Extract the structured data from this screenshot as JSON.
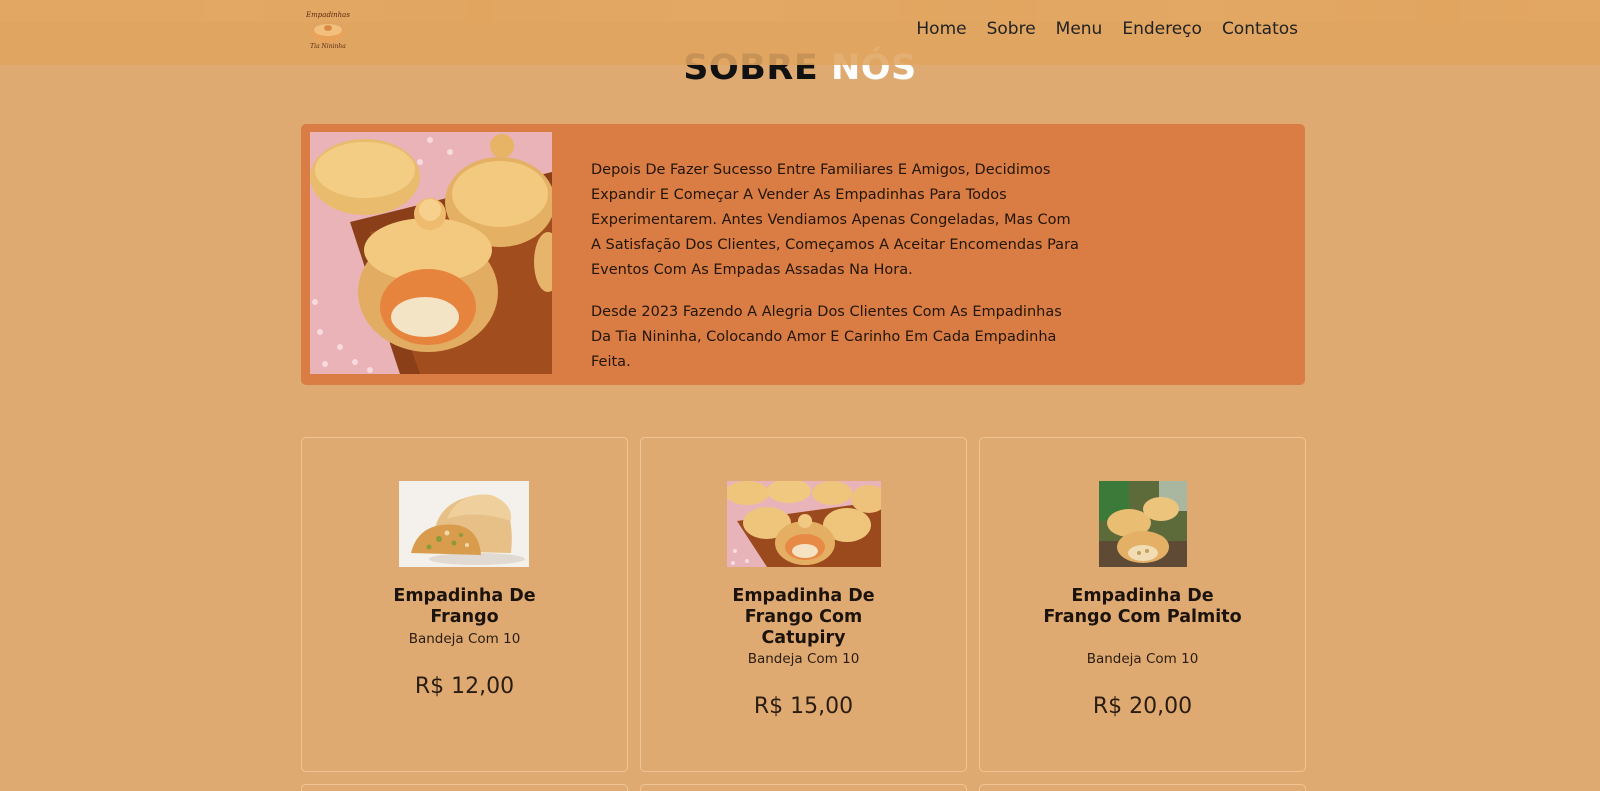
{
  "nav": {
    "logo_text_top": "Empadinhas",
    "logo_text_bottom": "Tia Nininha",
    "links": [
      "Home",
      "Sobre",
      "Menu",
      "Endereço",
      "Contatos"
    ]
  },
  "about": {
    "title_part1": "SOBRE",
    "title_part2": "NÓS",
    "paragraph1": "Depois De Fazer Sucesso Entre Familiares E Amigos, Decidimos Expandir E Começar A Vender As Empadinhas Para Todos Experimentarem. Antes Vendiamos Apenas Congeladas, Mas Com A Satisfação Dos Clientes, Começamos A Aceitar Encomendas Para Eventos Com As Empadas Assadas Na Hora.",
    "paragraph2": "Desde 2023 Fazendo A Alegria Dos Clientes Com As Empadinhas Da Tia Nininha, Colocando Amor E Carinho Em Cada Empadinha Feita."
  },
  "products": [
    {
      "name": "Empadinha De Frango",
      "desc": "Bandeja Com 10",
      "price": "R$ 12,00"
    },
    {
      "name": "Empadinha De Frango Com Catupiry",
      "desc": "Bandeja Com 10",
      "price": "R$ 15,00"
    },
    {
      "name": "Empadinha De Frango Com Palmito",
      "desc": "Bandeja Com 10",
      "price": "R$ 20,00"
    }
  ],
  "colors": {
    "page_bg": "#dfaa72",
    "navbar_bg": "#e0a45e",
    "about_card_bg": "#d97d44",
    "card_border": "#efc595"
  }
}
